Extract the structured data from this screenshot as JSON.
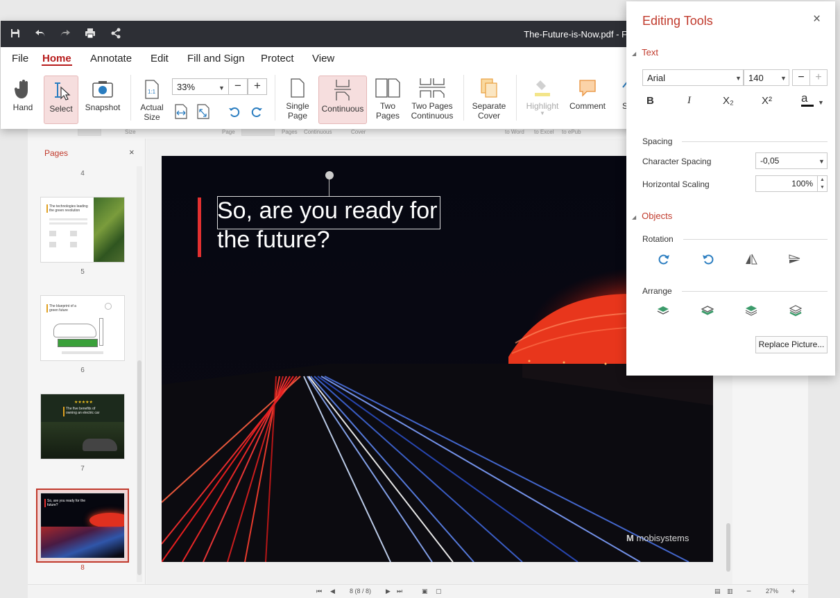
{
  "window": {
    "document_title": "The-Future-is-Now.pdf - F"
  },
  "menu": [
    "File",
    "Home",
    "Annotate",
    "Edit",
    "Fill and Sign",
    "Protect",
    "View"
  ],
  "ribbon": {
    "hand": "Hand",
    "select": "Select",
    "snapshot": "Snapshot",
    "actual_size_1": "Actual",
    "actual_size_2": "Size",
    "zoom_value": "33%",
    "zoom_minus": "−",
    "zoom_plus": "+",
    "single_page_1": "Single",
    "single_page_2": "Page",
    "continuous": "Continuous",
    "two_pages_1": "Two",
    "two_pages_2": "Pages",
    "two_pages_cont_1": "Two Pages",
    "two_pages_cont_2": "Continuous",
    "separate_cover_1": "Separate",
    "separate_cover_2": "Cover",
    "highlight": "Highlight",
    "comment": "Comment",
    "overflow": "S"
  },
  "back_ribbon_labels": [
    "Size",
    "Page",
    "Pages",
    "Continuous",
    "Cover",
    "to Word",
    "to Excel",
    "to ePub"
  ],
  "pages_panel": {
    "title": "Pages",
    "close": "×",
    "page_numbers": [
      "4",
      "5",
      "6",
      "7",
      "8"
    ],
    "thumb5_text": "The technologies leading the green revolution",
    "thumb6_text": "The blueprint of a green future",
    "thumb7_text": "The five benefits of owning an electric car",
    "thumb8_text": "So, are you ready for the future?"
  },
  "document": {
    "headline_line1": "So, are you ready for",
    "headline_line2": "the future?",
    "logo": "mobisystems"
  },
  "status_bar": {
    "page_indicator": "8 (8 / 8)",
    "zoom": "27%",
    "zoom_minus": "−",
    "zoom_plus": "+"
  },
  "editing_tools": {
    "title": "Editing Tools",
    "close": "×",
    "text_section": "Text",
    "font": "Arial",
    "font_size": "140",
    "size_minus": "−",
    "size_plus": "+",
    "bold": "B",
    "italic": "I",
    "subscript": "X₂",
    "superscript": "X²",
    "font_color": "a",
    "spacing_label": "Spacing",
    "char_spacing_label": "Character Spacing",
    "char_spacing_value": "-0,05",
    "h_scaling_label": "Horizontal Scaling",
    "h_scaling_value": "100%",
    "objects_section": "Objects",
    "rotation_label": "Rotation",
    "arrange_label": "Arrange",
    "replace_picture": "Replace Picture..."
  },
  "colors": {
    "accent": "#c0392b",
    "titlebar": "#2d2f35",
    "arrange_green": "#3c9b6b",
    "rotate_blue": "#2a7dc0"
  }
}
